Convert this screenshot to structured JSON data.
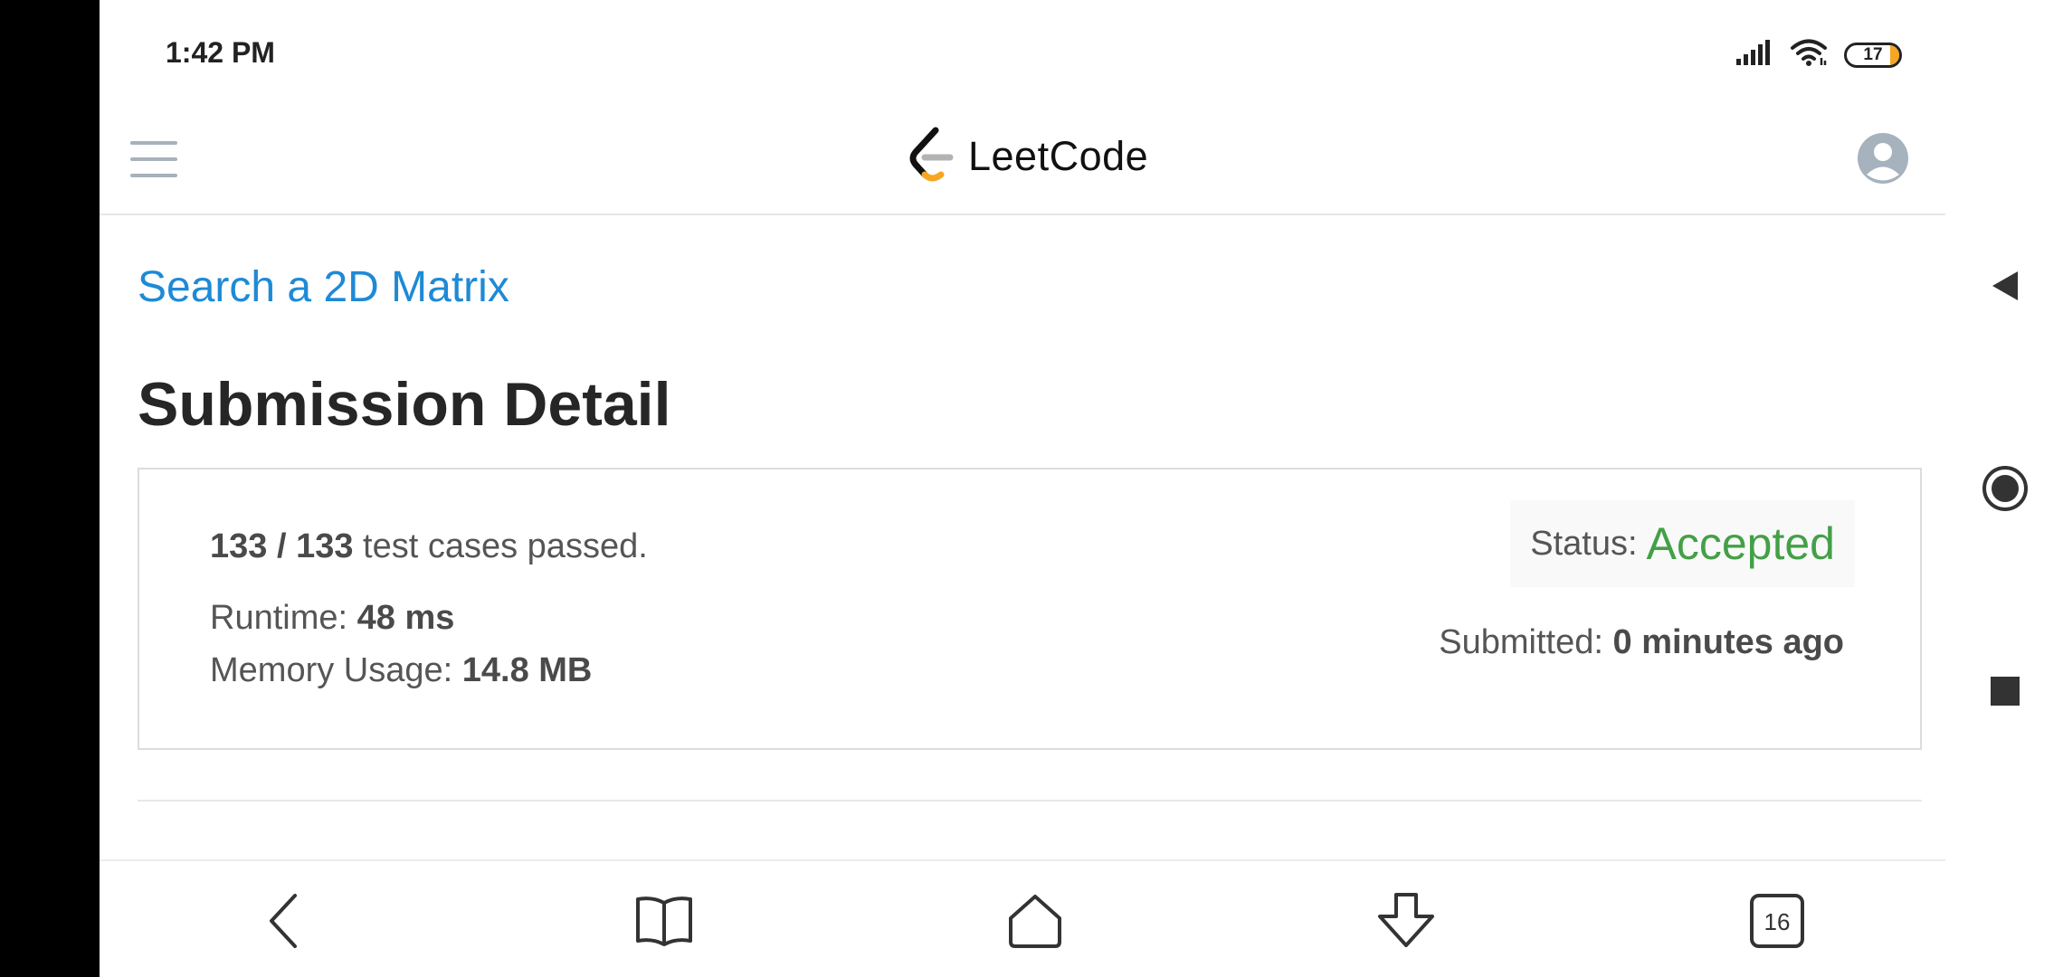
{
  "status_bar": {
    "time": "1:42 PM",
    "battery_level": "17",
    "icons": [
      "signal-icon",
      "wifi-icon",
      "battery-icon"
    ]
  },
  "header": {
    "logo_text": "LeetCode",
    "menu_icon": "hamburger-icon",
    "profile_icon": "avatar-icon"
  },
  "problem": {
    "title": "Search a 2D Matrix"
  },
  "page": {
    "title": "Submission Detail"
  },
  "submission": {
    "passed": "133 / 133",
    "passed_suffix": " test cases passed.",
    "runtime_label": "Runtime: ",
    "runtime_value": "48 ms",
    "memory_label": "Memory Usage: ",
    "memory_value": "14.8 MB",
    "status_label": "Status: ",
    "status_value": "Accepted",
    "submitted_label": "Submitted: ",
    "submitted_value": "0 minutes ago"
  },
  "bottom_nav": {
    "items": [
      "back-icon",
      "bookmarks-icon",
      "home-icon",
      "download-icon",
      "tabs-icon"
    ],
    "tab_count": "16"
  },
  "system_nav": [
    "back-triangle-icon",
    "home-circle-icon",
    "recents-square-icon"
  ],
  "colors": {
    "link": "#1e8ad6",
    "accepted": "#43a047",
    "logo_orange": "#f5a623"
  }
}
